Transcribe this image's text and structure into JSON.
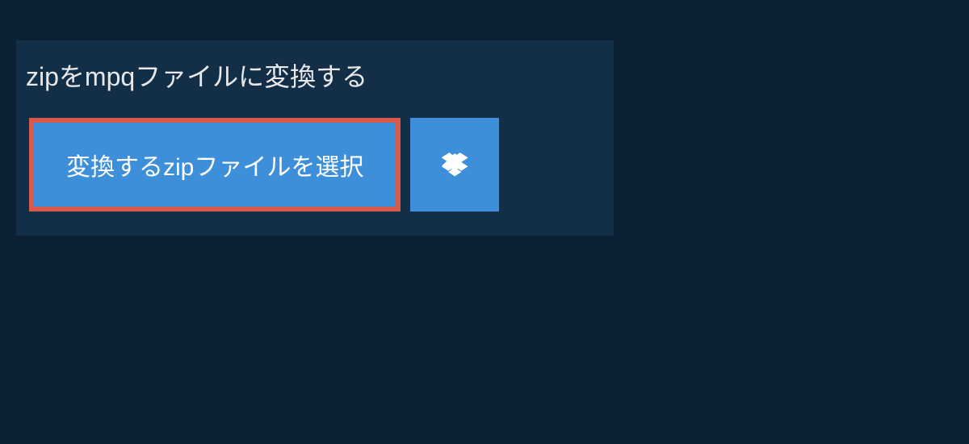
{
  "heading": "zipをmpqファイルに変換する",
  "buttons": {
    "select_file": "変換するzipファイルを選択"
  },
  "colors": {
    "background": "#0c2134",
    "panel": "#132e47",
    "button": "#3d8fd9",
    "highlight_border": "#d85a4a",
    "text": "#e8e8e8"
  }
}
